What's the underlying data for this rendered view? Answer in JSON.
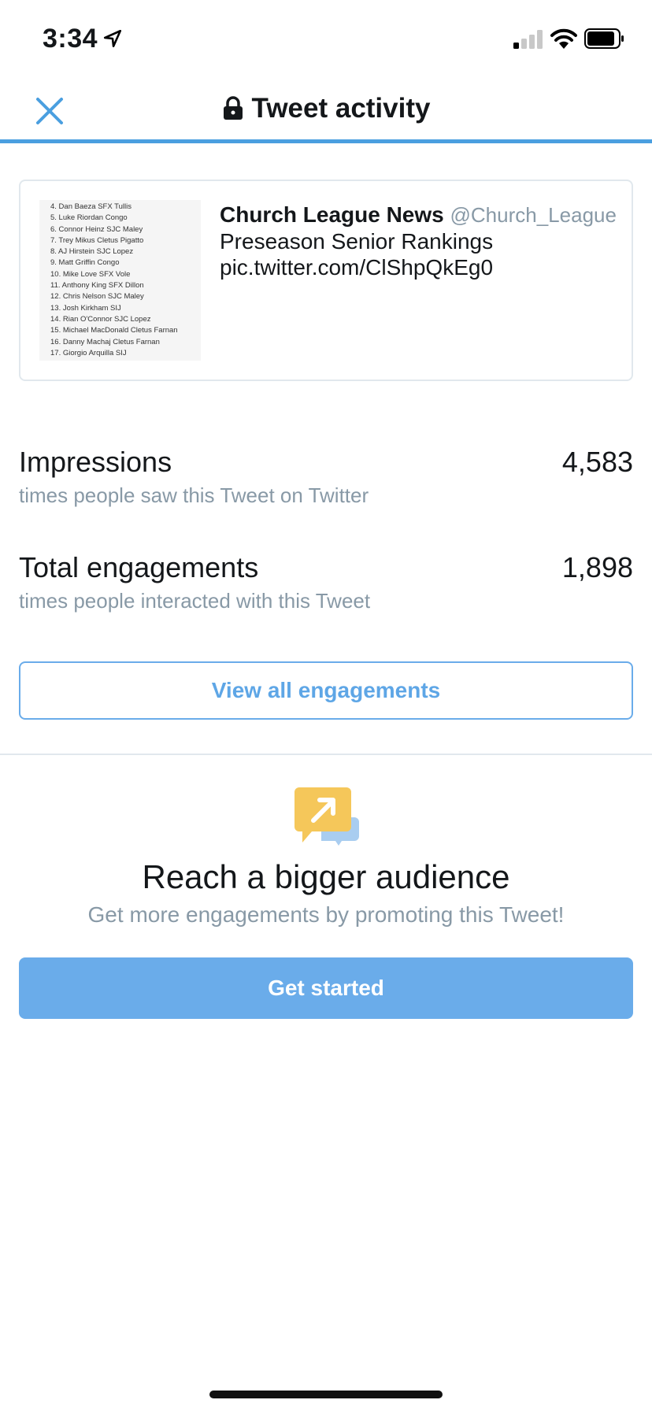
{
  "status_bar": {
    "time": "3:34"
  },
  "nav": {
    "title": "Tweet activity"
  },
  "tweet": {
    "author_name": "Church League News",
    "author_handle": "@Church_League",
    "text_line1": "Preseason Senior Rankings",
    "text_line2": "pic.twitter.com/ClShpQkEg0",
    "thumbnail_lines": [
      "4.  Dan Baeza SFX Tullis",
      "5.  Luke Riordan Congo",
      "6.  Connor Heinz SJC Maley",
      "7.  Trey Mikus Cletus Pigatto",
      "8.  AJ Hirstein SJC Lopez",
      "9.   Matt Griffin Congo",
      "10.  Mike Love SFX Vole",
      "11.  Anthony King SFX Dillon",
      "12.  Chris Nelson SJC Maley",
      "13.  Josh Kirkham SIJ",
      "14.  Rian O'Connor SJC Lopez",
      "15.  Michael MacDonald Cletus Farnan",
      "16.  Danny Machaj Cletus Farnan",
      "17.  Giorgio Arquilla SIJ"
    ]
  },
  "stats": {
    "impressions": {
      "label": "Impressions",
      "value": "4,583",
      "description": "times people saw this Tweet on Twitter"
    },
    "engagements": {
      "label": "Total engagements",
      "value": "1,898",
      "description": "times people interacted with this Tweet"
    }
  },
  "view_all_button": "View all engagements",
  "promo": {
    "title": "Reach a bigger audience",
    "subtitle": "Get more engagements by promoting this Tweet!",
    "cta": "Get started"
  },
  "colors": {
    "accent": "#4a9fe0",
    "button_blue": "#6aacea",
    "muted_text": "#8899a6",
    "promo_yellow": "#f5c75a",
    "promo_blue": "#a9cdf0"
  },
  "icons": [
    "location-arrow-icon",
    "signal-icon",
    "wifi-icon",
    "battery-icon",
    "close-icon",
    "lock-icon",
    "promote-icon"
  ]
}
